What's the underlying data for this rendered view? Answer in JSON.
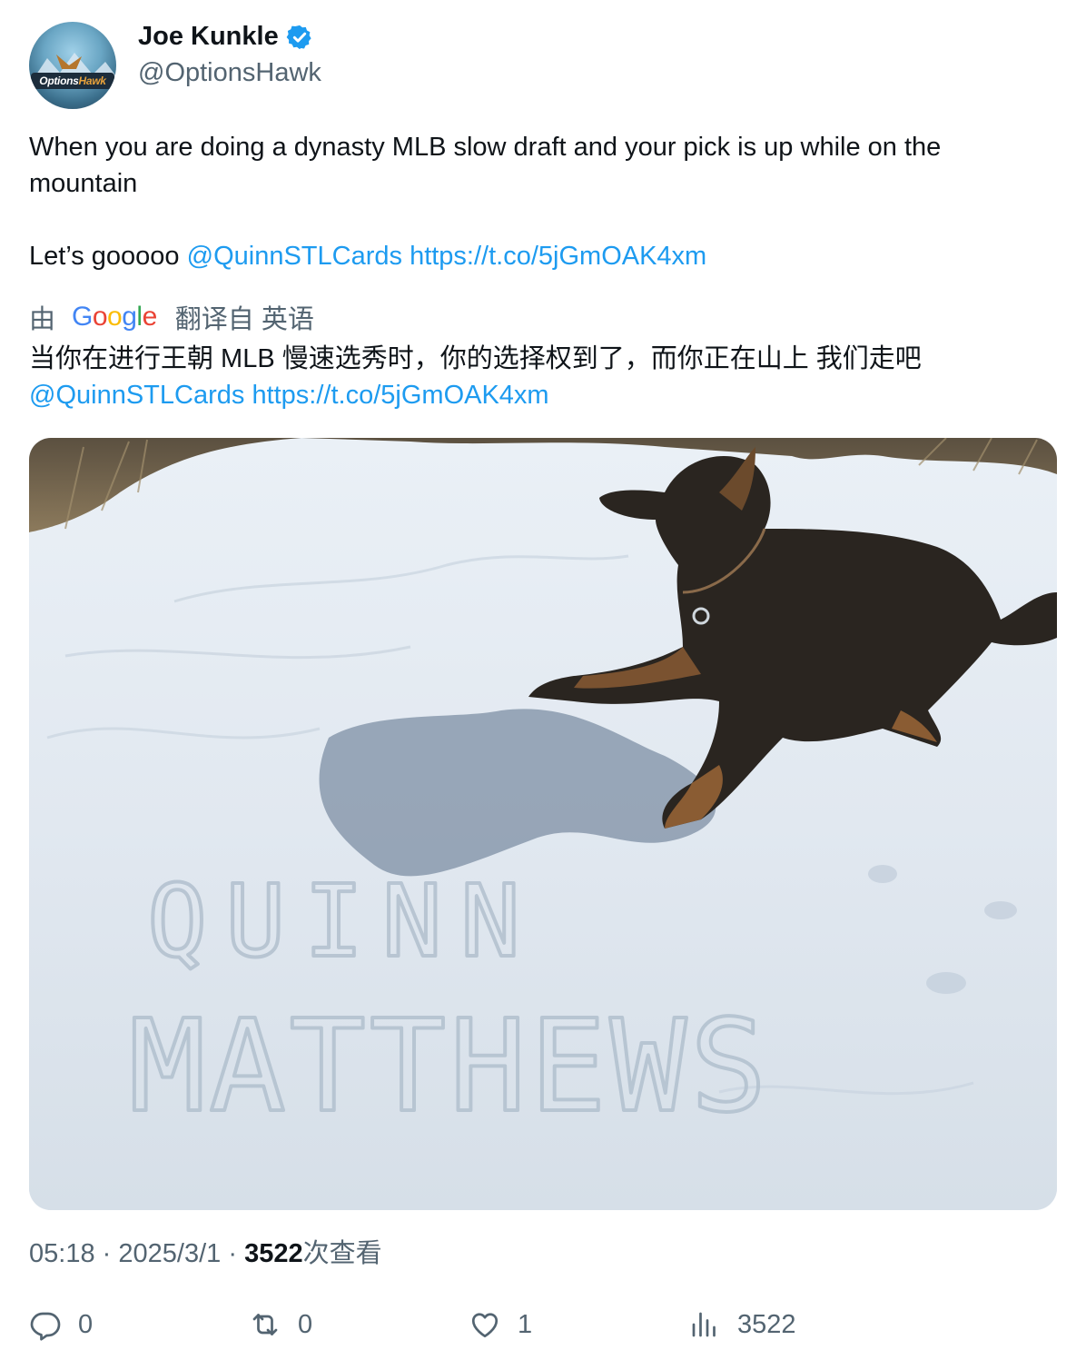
{
  "author": {
    "display_name": "Joe Kunkle",
    "handle": "@OptionsHawk",
    "verified": true,
    "avatar_text_a": "Options",
    "avatar_text_b": "Hawk"
  },
  "tweet": {
    "line1": "When you are doing a dynasty MLB slow draft and your pick is up while on the mountain",
    "line2_prefix": "Let’s gooooo ",
    "mention": "@QuinnSTLCards",
    "url": "https://t.co/5jGmOAK4xm"
  },
  "translation": {
    "by_prefix": "由",
    "provider": "Google",
    "suffix": "翻译自 英语",
    "text": "当你在进行王朝 MLB 慢速选秀时，你的选择权到了，而你正在山上 我们走吧",
    "mention": "@QuinnSTLCards",
    "url": "https://t.co/5jGmOAK4xm"
  },
  "photo": {
    "snow_text_line1": "QUINN",
    "snow_text_line2": "MATTHEWS"
  },
  "meta": {
    "time": "05:18",
    "separator": "·",
    "date": "2025/3/1",
    "views_count": "3522",
    "views_label": "次查看"
  },
  "actions": {
    "reply_count": "0",
    "retweet_count": "0",
    "like_count": "1",
    "views_count": "3522"
  },
  "colors": {
    "link": "#1d9bf0",
    "secondary": "#536471",
    "text": "#0f1419"
  }
}
